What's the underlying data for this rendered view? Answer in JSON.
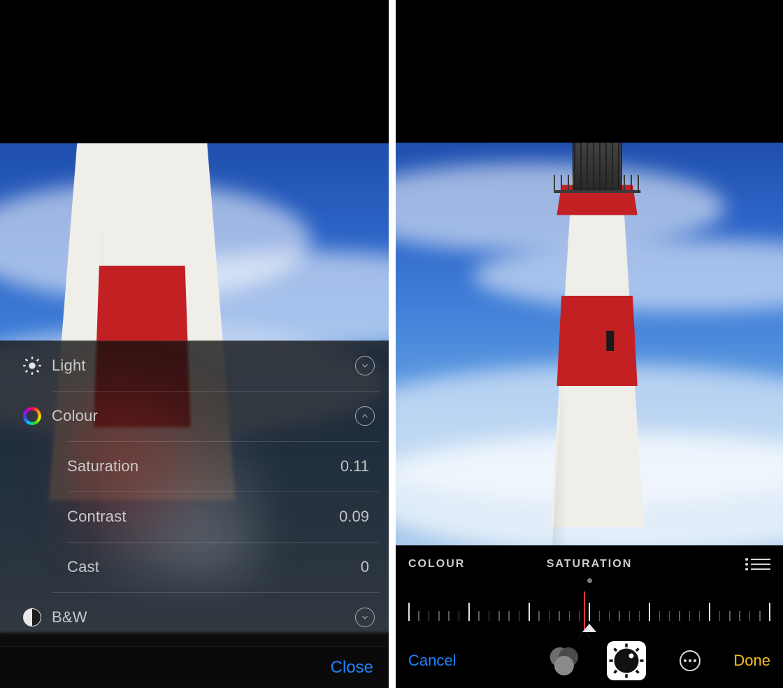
{
  "left": {
    "categories": {
      "light": {
        "label": "Light",
        "expanded": false
      },
      "colour": {
        "label": "Colour",
        "expanded": true,
        "items": [
          {
            "label": "Saturation",
            "value": "0.11"
          },
          {
            "label": "Contrast",
            "value": "0.09"
          },
          {
            "label": "Cast",
            "value": "0"
          }
        ]
      },
      "bw": {
        "label": "B&W",
        "expanded": false
      }
    },
    "close_label": "Close"
  },
  "right": {
    "header": {
      "category": "COLOUR",
      "adjustment": "SATURATION"
    },
    "toolbar": {
      "cancel": "Cancel",
      "done": "Done"
    }
  },
  "colors": {
    "accent_blue": "#1e82ff",
    "accent_yellow": "#f4c021",
    "needle_red": "#ff3830"
  }
}
